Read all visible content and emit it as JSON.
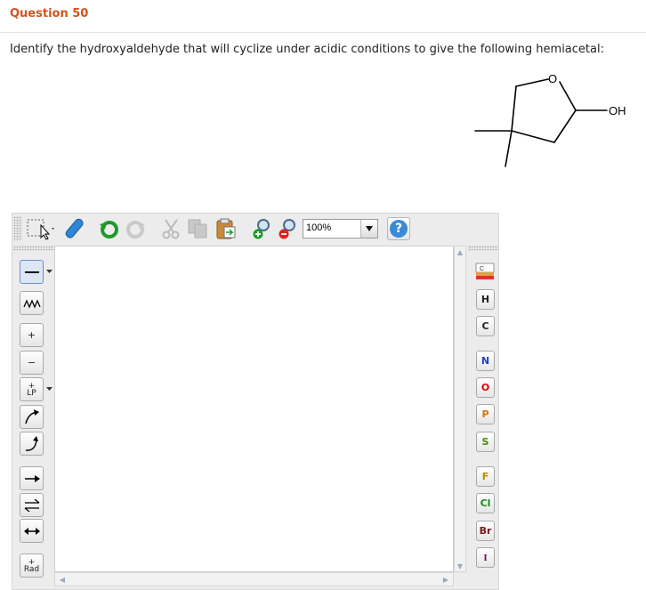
{
  "question": {
    "title": "Question 50",
    "text": "Identify the hydroxyaldehyde that will cyclize under acidic conditions to give the following hemiacetal:"
  },
  "molecule": {
    "ring_oxygen_label": "O",
    "substituent_label": "OH"
  },
  "toolbar": {
    "zoom_value": "100%",
    "help_label": "?",
    "icons": [
      "select-icon",
      "eraser-icon",
      "undo-icon",
      "redo-icon",
      "cut-icon",
      "copy-icon",
      "paste-icon",
      "zoom-in-icon",
      "zoom-out-icon",
      "help-icon"
    ]
  },
  "left_tools": {
    "charge_plus": "+",
    "charge_minus": "−",
    "lone_pair_label": "LP",
    "radical_label": "Rad",
    "lone_pair_plus": "+",
    "radical_plus": "+"
  },
  "elements": [
    {
      "symbol": "H",
      "color": "#222222"
    },
    {
      "symbol": "C",
      "color": "#222222"
    },
    {
      "symbol": "N",
      "color": "#1f3fd0"
    },
    {
      "symbol": "O",
      "color": "#e00000"
    },
    {
      "symbol": "P",
      "color": "#d07a00"
    },
    {
      "symbol": "S",
      "color": "#4a8a00"
    },
    {
      "symbol": "F",
      "color": "#b88a00"
    },
    {
      "symbol": "Cl",
      "color": "#1a8a1a"
    },
    {
      "symbol": "Br",
      "color": "#7a1a1a"
    },
    {
      "symbol": "I",
      "color": "#6a006a"
    }
  ]
}
